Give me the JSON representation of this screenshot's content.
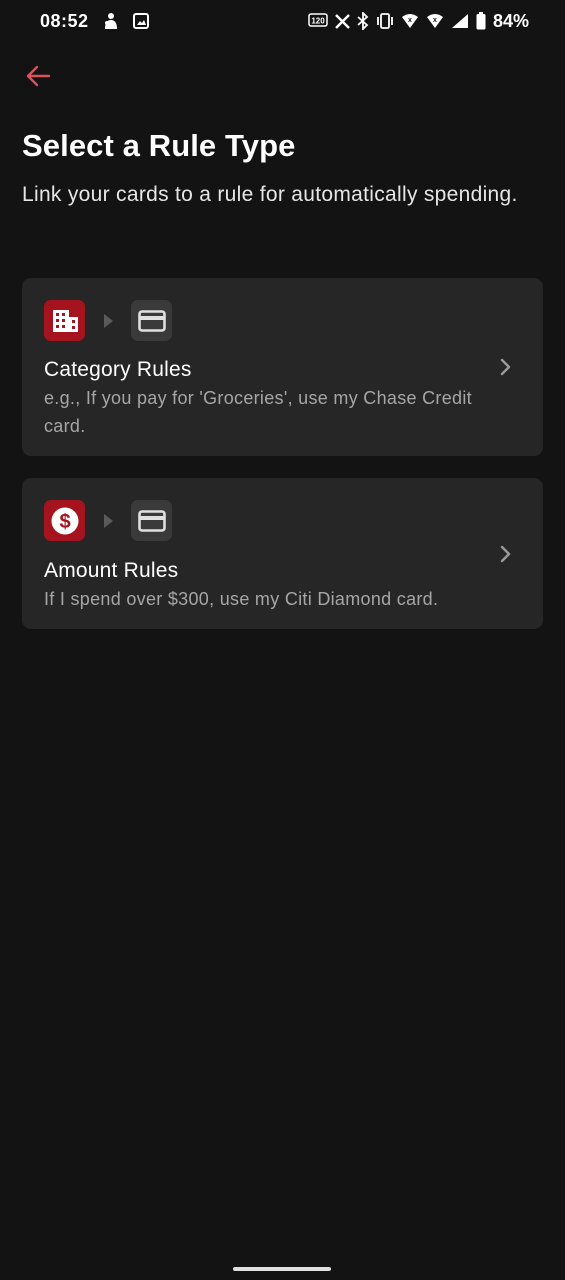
{
  "status_bar": {
    "time": "08:52",
    "battery": "84%",
    "refresh_rate_badge": "120",
    "left_icons": [
      "notification-app-icon",
      "image-icon"
    ],
    "right_icons": [
      "refresh-rate-icon",
      "x-app-icon",
      "bluetooth-icon",
      "vibrate-icon",
      "wifi-icon",
      "wifi-icon",
      "signal-icon",
      "battery-icon"
    ]
  },
  "header": {
    "back_icon": "arrow-left-icon",
    "title": "Select a Rule Type",
    "subtitle": "Link your cards to a rule for automatically spending."
  },
  "rules": [
    {
      "title": "Category Rules",
      "description": "e.g., If you pay for 'Groceries', use my Chase Credit card.",
      "source_icon": "building-icon",
      "target_icon": "credit-card-icon"
    },
    {
      "title": "Amount Rules",
      "description": "If I spend over $300, use my Citi Diamond card.",
      "source_icon": "dollar-icon",
      "target_icon": "credit-card-icon"
    }
  ],
  "colors": {
    "background": "#131313",
    "card": "#262626",
    "accent": "#a5141e",
    "back_arrow": "#d9535b",
    "muted_text": "#a6a6a6"
  }
}
